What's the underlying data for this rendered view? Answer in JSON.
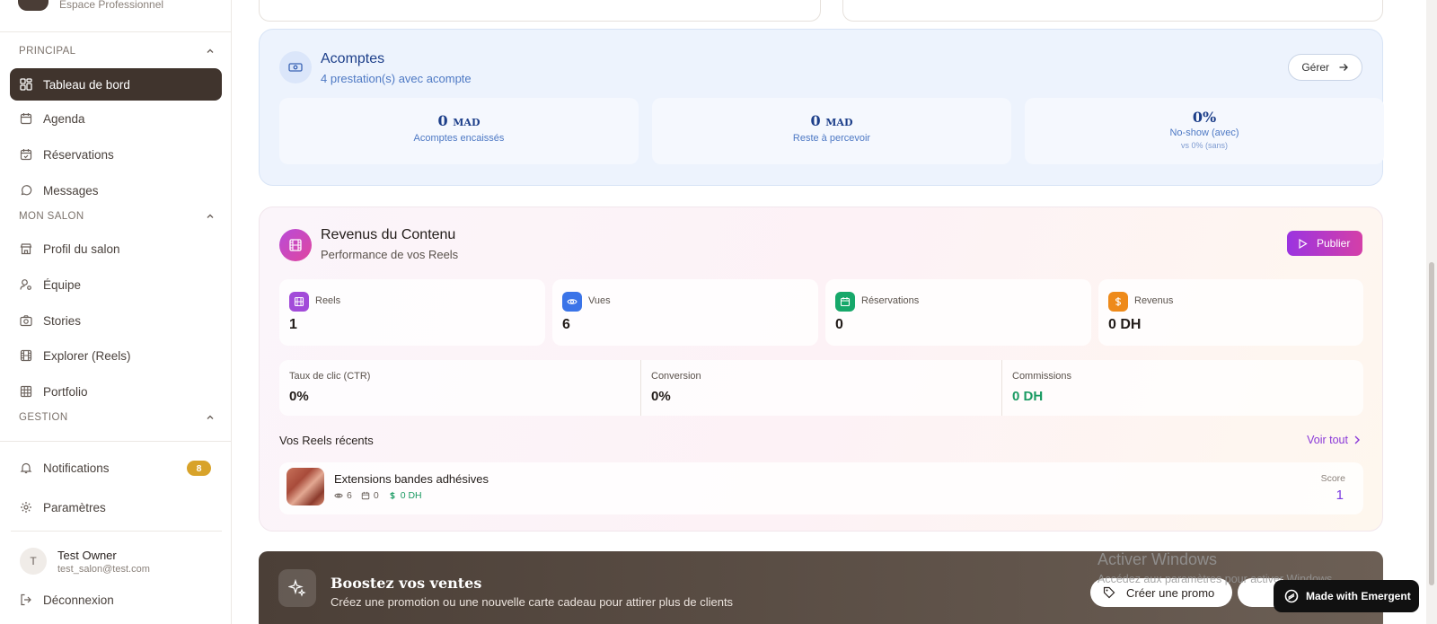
{
  "sidebar": {
    "brand_sub": "Espace Professionnel",
    "sections": {
      "principal": "PRINCIPAL",
      "mon_salon": "MON SALON",
      "gestion": "GESTION"
    },
    "items": {
      "dashboard": "Tableau de bord",
      "agenda": "Agenda",
      "reservations": "Réservations",
      "messages": "Messages",
      "profil": "Profil du salon",
      "equipe": "Équipe",
      "stories": "Stories",
      "explorer": "Explorer (Reels)",
      "portfolio": "Portfolio",
      "notifications": "Notifications",
      "parametres": "Paramètres"
    },
    "notifications_count": "8",
    "user": {
      "initial": "T",
      "name": "Test Owner",
      "email": "test_salon@test.com"
    },
    "logout": "Déconnexion"
  },
  "acomptes": {
    "title": "Acomptes",
    "subtitle": "4 prestation(s) avec acompte",
    "manage_label": "Gérer",
    "stats": [
      {
        "value": "0",
        "unit": "MAD",
        "label": "Acomptes encaissés"
      },
      {
        "value": "0",
        "unit": "MAD",
        "label": "Reste à percevoir"
      },
      {
        "value": "0%",
        "unit": "",
        "label": "No-show (avec)",
        "sub": "vs 0% (sans)"
      }
    ]
  },
  "revenus": {
    "title": "Revenus du Contenu",
    "subtitle": "Performance de vos Reels",
    "publish_label": "Publier",
    "metrics": [
      {
        "label": "Reels",
        "value": "1"
      },
      {
        "label": "Vues",
        "value": "6"
      },
      {
        "label": "Réservations",
        "value": "0"
      },
      {
        "label": "Revenus",
        "value": "0 DH"
      }
    ],
    "rates": [
      {
        "label": "Taux de clic (CTR)",
        "value": "0%"
      },
      {
        "label": "Conversion",
        "value": "0%"
      },
      {
        "label": "Commissions",
        "value": "0 DH"
      }
    ],
    "recent_title": "Vos Reels récents",
    "see_all": "Voir tout",
    "reel": {
      "name": "Extensions bandes adhésives",
      "views": "6",
      "bookings": "0",
      "revenue": "0 DH",
      "score_label": "Score",
      "score": "1"
    }
  },
  "boost": {
    "title": "Boostez vos ventes",
    "subtitle": "Créez une promotion ou une nouvelle carte cadeau pour attirer plus de clients",
    "promo_label": "Créer une promo"
  },
  "watermark": {
    "line1": "Activer Windows",
    "line2": "Accédez aux paramètres pour activer Windows."
  },
  "emergent_badge": "Made with Emergent",
  "colors": {
    "accent_dark": "#40342d",
    "acomptes_bg": "#edf3fd",
    "publish_gradient_start": "#9b34e0",
    "publish_gradient_end": "#d43fa8",
    "commission_green": "#1a9a62",
    "badge_gold": "#d8a32a"
  }
}
